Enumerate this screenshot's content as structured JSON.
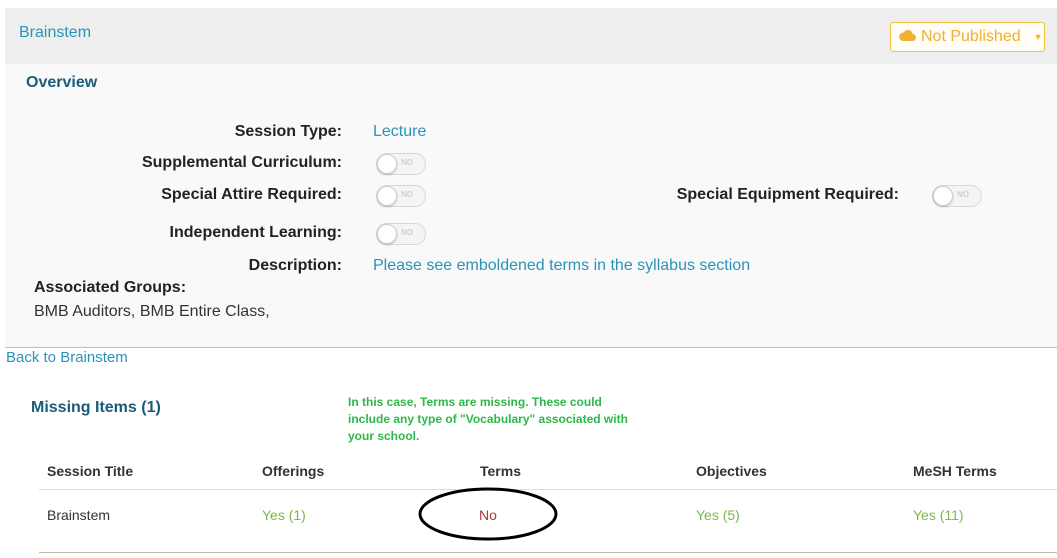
{
  "header": {
    "session_title": "Brainstem",
    "publish_status": "Not Published",
    "publish_color": "#f0b030"
  },
  "overview": {
    "title": "Overview",
    "session_type_label": "Session Type:",
    "session_type_value": "Lecture",
    "supplemental_label": "Supplemental Curriculum:",
    "special_attire_label": "Special Attire Required:",
    "special_equipment_label": "Special Equipment Required:",
    "independent_learning_label": "Independent Learning:",
    "toggle_text": "NO",
    "description_label": "Description:",
    "description_value": "Please see emboldened terms in the syllabus section",
    "groups_label": "Associated Groups:",
    "groups_value": "BMB Auditors, BMB Entire Class,"
  },
  "back_link": "Back to Brainstem",
  "missing": {
    "title": "Missing Items (1)",
    "annotation": "In this case, Terms are missing.  These could include any type of \"Vocabulary\" associated with your school.",
    "columns": [
      "Session Title",
      "Offerings",
      "Terms",
      "Objectives",
      "MeSH Terms"
    ],
    "rows": [
      [
        "Brainstem",
        "Yes (1)",
        "No",
        "Yes (5)",
        "Yes (11)"
      ]
    ]
  },
  "colors": {
    "link": "#2a93b8",
    "heading": "#1b5b7a",
    "annotation": "#2db84a",
    "yes": "#7ab84a",
    "no": "#b03a3a"
  }
}
